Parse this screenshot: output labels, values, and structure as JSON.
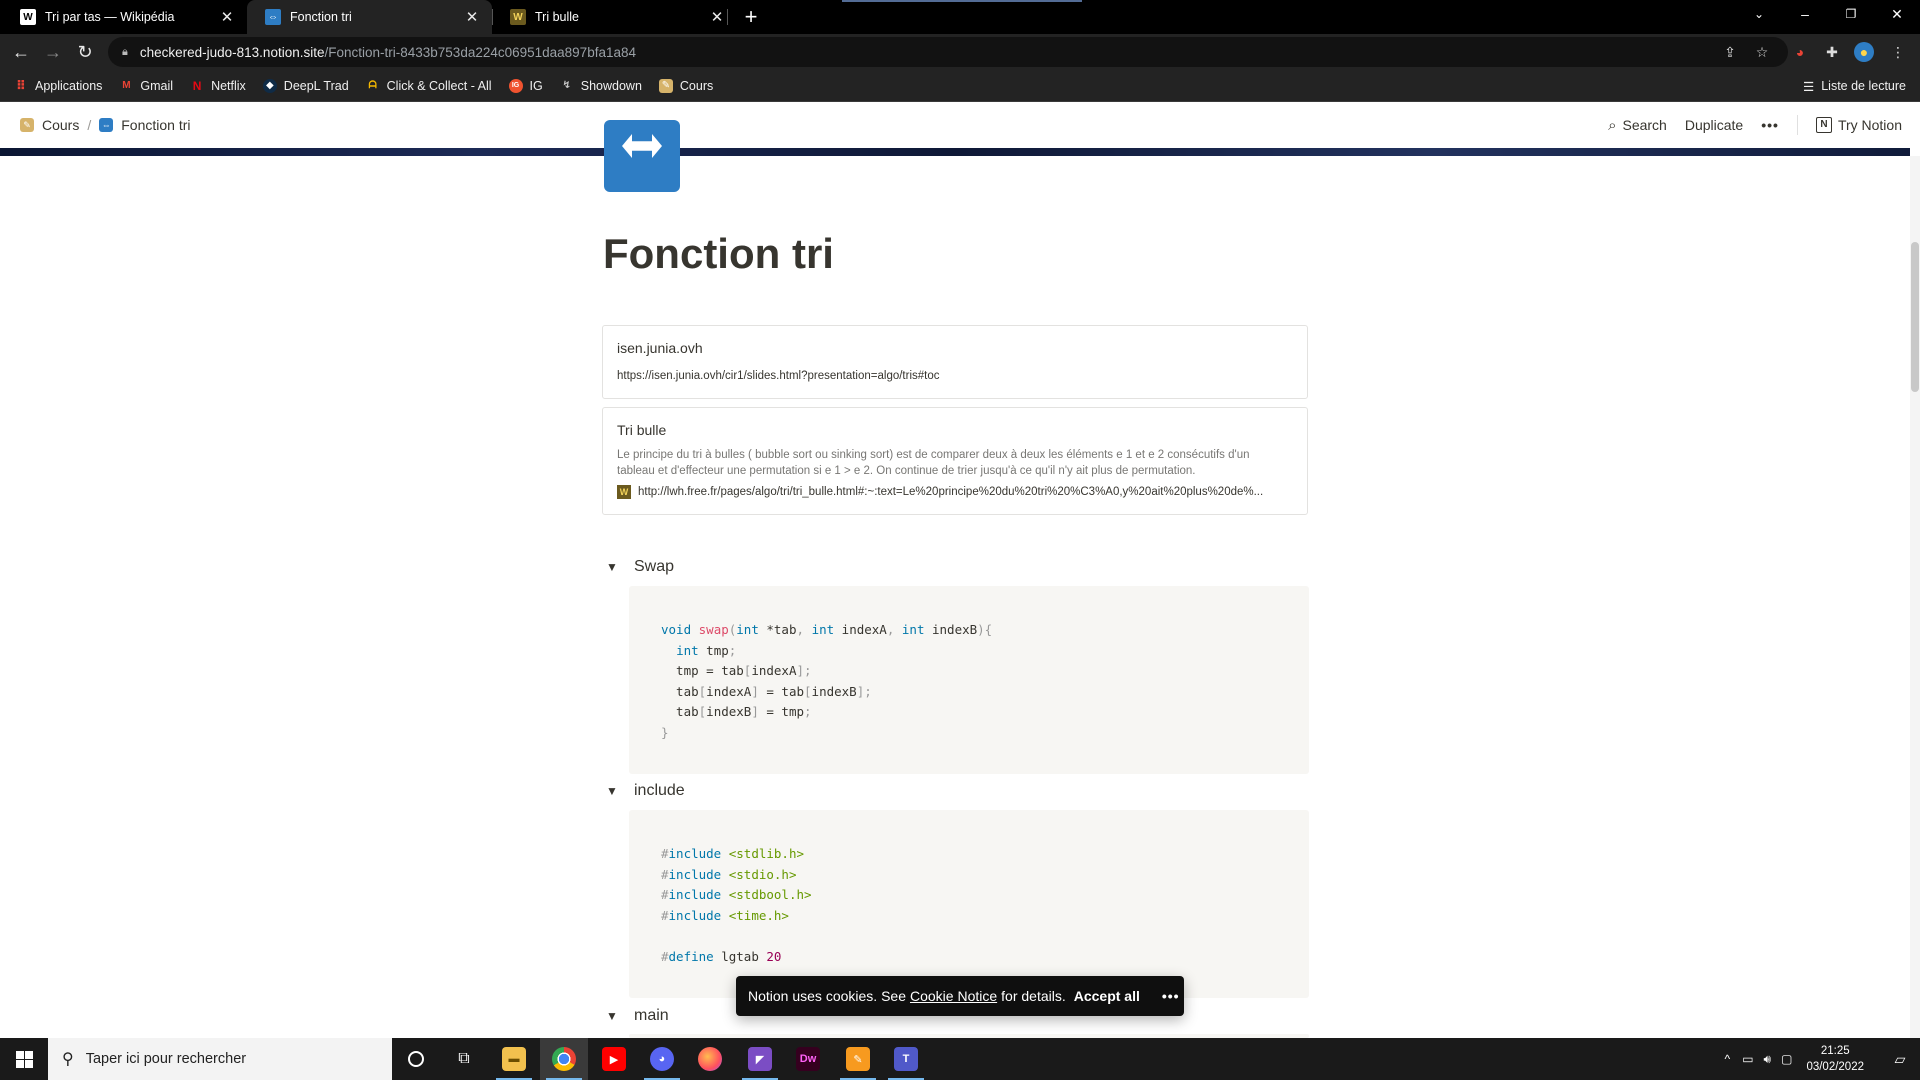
{
  "browser": {
    "tabs": [
      {
        "title": "Tri par tas — Wikipédia",
        "favicon": "W",
        "active": false
      },
      {
        "title": "Fonction tri",
        "favicon": "⇔",
        "active": true
      },
      {
        "title": "Tri bulle",
        "favicon": "W",
        "active": false
      }
    ],
    "url_host": "checkered-judo-813.notion.site",
    "url_path": "/Fonction-tri-8433b753da224c06951daa897bfa1a84",
    "bookmarks": [
      {
        "label": "Applications",
        "icon": "apps-grid-icon",
        "color": "#e94235"
      },
      {
        "label": "Gmail",
        "icon": "gmail-icon",
        "color": "#ea4335"
      },
      {
        "label": "Netflix",
        "icon": "netflix-icon",
        "color": "#e50914"
      },
      {
        "label": "DeepL Trad",
        "icon": "deepl-icon",
        "color": "#0f2b46"
      },
      {
        "label": "Click & Collect - All",
        "icon": "click-collect-icon",
        "color": "#f5b800"
      },
      {
        "label": "IG",
        "icon": "ig-icon",
        "color": "#f0532f"
      },
      {
        "label": "Showdown",
        "icon": "showdown-icon",
        "color": "#9aa0a6"
      },
      {
        "label": "Cours",
        "icon": "notebook-icon",
        "color": "#d6b36a"
      }
    ],
    "reading_list": "Liste de lecture"
  },
  "notion": {
    "breadcrumb": [
      {
        "label": "Cours",
        "icon": "notebook-icon"
      },
      {
        "label": "Fonction tri",
        "icon": "arrows-icon"
      }
    ],
    "search": "Search",
    "duplicate": "Duplicate",
    "more": "•••",
    "try_notion": "Try Notion"
  },
  "page": {
    "title": "Fonction tri",
    "bookmarks": [
      {
        "title": "isen.junia.ovh",
        "url": "https://isen.junia.ovh/cir1/slides.html?presentation=algo/tris#toc"
      },
      {
        "title": "Tri bulle",
        "description_line1": "Le principe du tri à bulles ( bubble sort ou sinking sort) est de comparer deux à deux les éléments e 1 et e 2 consécutifs d'un",
        "description_line2": "tableau et d'effecteur une permutation si e 1 > e 2. On continue de trier jusqu'à ce qu'il n'y ait plus de permutation.",
        "url": "http://lwh.free.fr/pages/algo/tri/tri_bulle.html#:~:text=Le%20principe%20du%20tri%20%C3%A0,y%20ait%20plus%20de%..."
      }
    ],
    "toggles": [
      {
        "label": "Swap"
      },
      {
        "label": "include"
      },
      {
        "label": "main"
      }
    ]
  },
  "cookie": {
    "text_before": "Notion uses cookies. See",
    "link": "Cookie Notice",
    "text_after": "for details.",
    "accept": "Accept all",
    "more": "•••"
  },
  "taskbar": {
    "search_placeholder": "Taper ici pour rechercher",
    "time": "21:25",
    "date": "03/02/2022"
  }
}
